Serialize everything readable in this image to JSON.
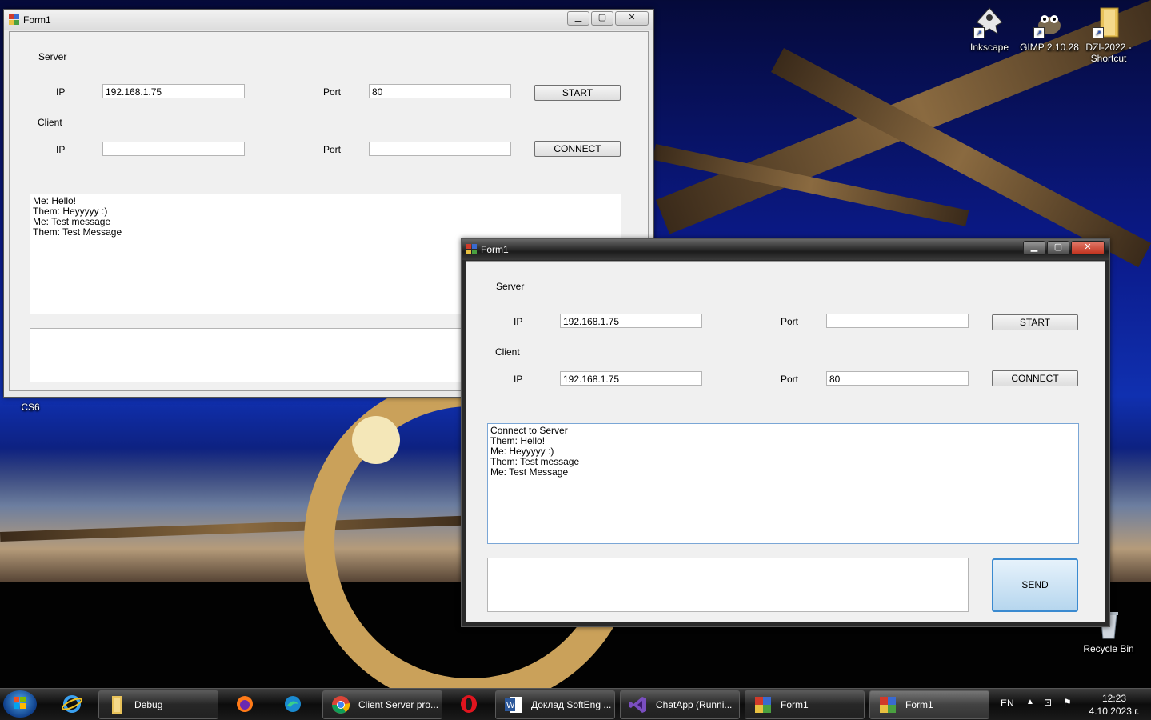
{
  "desktop": {
    "icons": [
      {
        "label": "Inkscape",
        "icon": "inkscape-icon"
      },
      {
        "label": "GIMP 2.10.28",
        "icon": "gimp-icon"
      },
      {
        "label": "DZI-2022 - Shortcut",
        "icon": "folder-icon"
      },
      {
        "label": "Recycle Bin",
        "icon": "recycle-bin-icon"
      }
    ],
    "partial_label": "CS6"
  },
  "window1": {
    "title": "Form1",
    "server_label": "Server",
    "client_label": "Client",
    "ip_label": "IP",
    "port_label": "Port",
    "server_ip": "192.168.1.75",
    "server_port": "80",
    "client_ip": "",
    "client_port": "",
    "start_label": "START",
    "connect_label": "CONNECT",
    "chat_lines": [
      "Me: Hello!",
      "Them: Heyyyyy :)",
      "Me: Test message",
      "Them: Test Message"
    ],
    "message_input": ""
  },
  "window2": {
    "title": "Form1",
    "server_label": "Server",
    "client_label": "Client",
    "ip_label": "IP",
    "port_label": "Port",
    "server_ip": "192.168.1.75",
    "server_port": "",
    "client_ip": "192.168.1.75",
    "client_port": "80",
    "start_label": "START",
    "connect_label": "CONNECT",
    "chat_lines": [
      "Connect to Server",
      "Them: Hello!",
      "Me: Heyyyyy :)",
      "Them: Test message",
      "Me: Test Message"
    ],
    "message_input": "",
    "send_label": "SEND"
  },
  "taskbar": {
    "pinned": [
      "internet-explorer-icon",
      "firefox-icon",
      "edge-icon",
      "opera-icon"
    ],
    "tasks": [
      {
        "label": "Debug",
        "icon": "folder-icon"
      },
      {
        "label": "Client Server pro...",
        "icon": "chrome-icon"
      },
      {
        "label": "Доклад SoftEng ...",
        "icon": "word-icon"
      },
      {
        "label": "ChatApp (Runni...",
        "icon": "visual-studio-icon"
      },
      {
        "label": "Form1",
        "icon": "form-app-icon"
      },
      {
        "label": "Form1",
        "icon": "form-app-icon"
      }
    ],
    "language": "EN",
    "time": "12:23",
    "date": "4.10.2023 г."
  },
  "colors": {
    "window_bg": "#f0f0f0",
    "send_button_border": "#3a8ad0",
    "close_button": "#c0301c"
  }
}
